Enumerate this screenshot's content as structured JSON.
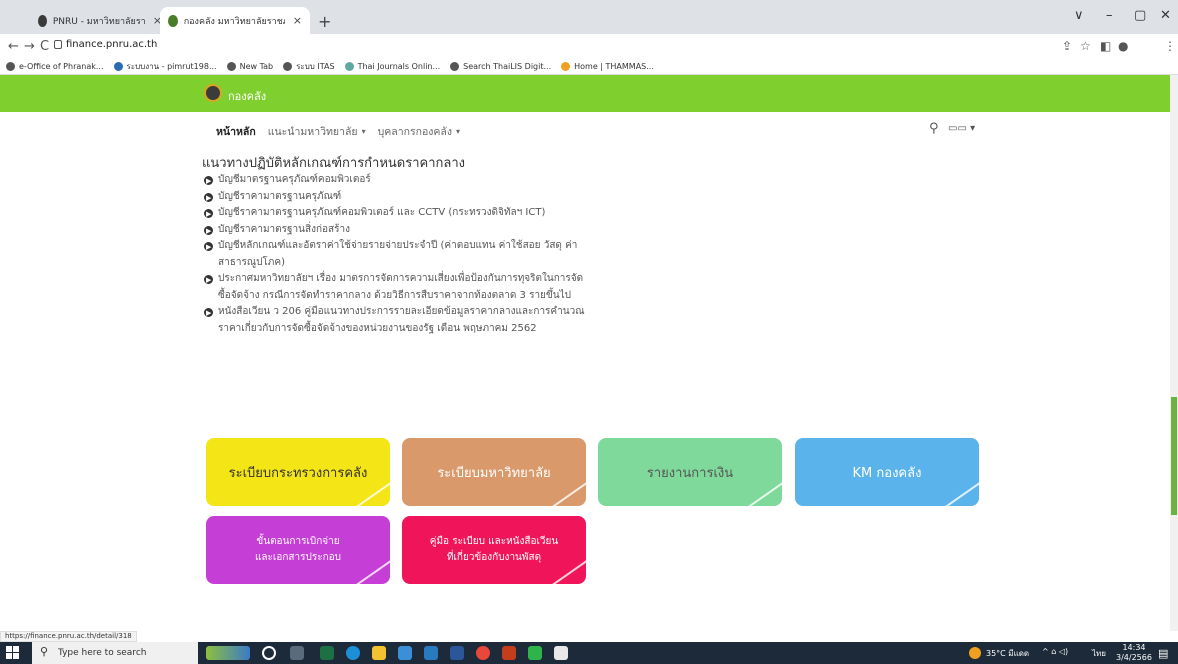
{
  "browser": {
    "tabs": [
      {
        "title": "PNRU - มหาวิทยาลัยราชภัฏพระนคร",
        "close": "×"
      },
      {
        "title": "กองคลัง มหาวิทยาลัยราชภัฏพระนคร",
        "close": "×"
      }
    ],
    "new_tab": "+",
    "window_controls": {
      "chevron": "∨",
      "minimize": "–",
      "restore": "▢",
      "close": "✕"
    },
    "nav": {
      "back": "←",
      "forward": "→",
      "reload": "C"
    },
    "url": "finance.pnru.ac.th",
    "bookmarks": [
      "e-Office of Phranak...",
      "ระบบงาน - pimrut198...",
      "New Tab",
      "ระบบ ITAS",
      "Thai Journals Onlin...",
      "Search ThaiLIS Digit...",
      "Home | THAMMAS..."
    ],
    "status_url": "https://finance.pnru.ac.th/detail/318"
  },
  "site": {
    "brand": "กองคลัง",
    "menu": [
      {
        "label": "หน้าหลัก",
        "active": true,
        "caret": ""
      },
      {
        "label": "แนะนำมหาวิทยาลัย",
        "active": false,
        "caret": "▾"
      },
      {
        "label": "บุคลากรกองคลัง",
        "active": false,
        "caret": "▾"
      }
    ],
    "lang_label": "▭▭ ▾",
    "heading": "แนวทางปฏิบัติหลักเกณฑ์การกำหนดราคากลาง",
    "links": [
      "บัญชีมาตรฐานครุภัณฑ์คอมพิวเตอร์",
      "บัญชีราคามาตรฐานครุภัณฑ์",
      "บัญชีราคามาตรฐานครุภัณฑ์คอมพิวเตอร์ และ CCTV (กระทรวงดิจิทัลฯ ICT)",
      "บัญชีราคามาตรฐานสิ่งก่อสร้าง",
      "บัญชีหลักเกณฑ์และอัตราค่าใช้จ่ายรายจ่ายประจำปี (ค่าตอบแทน ค่าใช้สอย วัสดุ ค่าสาธารณูปโภค)",
      "ประกาศมหาวิทยาลัยฯ เรื่อง มาตรการจัดการความเสี่ยงเพื่อป้องกันการทุจริตในการจัดซื้อจัดจ้าง กรณีการจัดทำราคากลาง ด้วยวิธีการสืบราคาจากท้องตลาด 3 รายขึ้นไป",
      "หนังสือเวียน ว 206 คู่มือแนวทางประการรายละเอียดข้อมูลราคากลางและการคำนวณราคาเกี่ยวกับการจัดซื้อจัดจ้างของหน่วยงานของรัฐ เดือน พฤษภาคม 2562"
    ],
    "tiles": [
      {
        "label": "ระเบียบกระทรวงการคลัง",
        "color": "#f4e516",
        "text_color": "#333"
      },
      {
        "label": "ระเบียบมหาวิทยาลัย",
        "color": "#d9996a",
        "text_color": "#fff"
      },
      {
        "label": "รายงานการเงิน",
        "color": "#7fd99a",
        "text_color": "#555"
      },
      {
        "label": "KM กองคลัง",
        "color": "#5ab3ea",
        "text_color": "#fff"
      },
      {
        "label": "ขั้นตอนการเบิกจ่าย\nและเอกสารประกอบ",
        "color": "#c53ed6",
        "text_color": "#fff"
      },
      {
        "label": "คู่มือ ระเบียบ และหนังสือเวียน\nที่เกี่ยวข้องกับงานพัสดุ",
        "color": "#f0145a",
        "text_color": "#fff"
      }
    ]
  },
  "taskbar": {
    "search_placeholder": "Type here to search",
    "weather": "35°C มีแดด",
    "lang": "ไทย",
    "time": "14:34",
    "date": "3/4/2566"
  }
}
